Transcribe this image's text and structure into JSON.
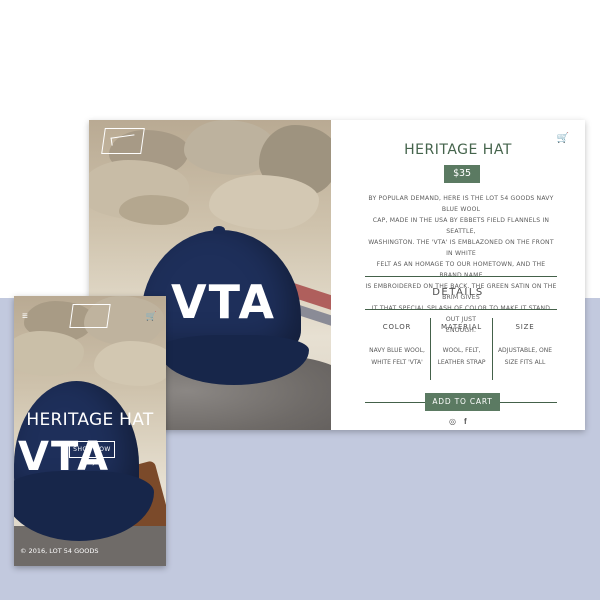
{
  "colors": {
    "accent_green": "#5b7a62",
    "heading_green": "#45644c",
    "navy_cap": "#1e2f5a",
    "backdrop_blue": "#c2c9de"
  },
  "desktop": {
    "title": "HERITAGE HAT",
    "price": "$35",
    "cart_icon": "cart-icon",
    "description_lines": [
      "BY POPULAR DEMAND, HERE IS THE LOT 54 GOODS NAVY BLUE WOOL",
      "CAP, MADE IN THE USA BY EBBETS FIELD FLANNELS IN SEATTLE,",
      "WASHINGTON. THE 'VTA' IS EMBLAZONED ON THE FRONT IN WHITE",
      "FELT AS AN HOMAGE TO OUR HOMETOWN, AND THE BRAND NAME",
      "IS EMBROIDERED ON THE BACK. THE GREEN SATIN ON THE BRIM GIVES",
      "IT THAT SPECIAL SPLASH OF COLOR TO MAKE IT STAND OUT JUST",
      "ENOUGH."
    ],
    "details_heading": "DETAILS",
    "specs": [
      {
        "label": "COLOR",
        "value_lines": [
          "NAVY BLUE WOOL,",
          "WHITE FELT 'VTA'"
        ]
      },
      {
        "label": "MATERIAL",
        "value_lines": [
          "WOOL, FELT,",
          "LEATHER STRAP"
        ]
      },
      {
        "label": "SIZE",
        "value_lines": [
          "ADJUSTABLE, ONE",
          "SIZE FITS ALL"
        ]
      }
    ],
    "add_to_cart": "ADD TO CART",
    "social": {
      "instagram_glyph": "◎",
      "facebook_glyph": "f"
    },
    "photo_text": "VTA"
  },
  "mobile": {
    "menu_glyph": "≡",
    "cart_glyph": "🛒",
    "title": "HERITAGE HAT",
    "shop_now": "SHOP NOW →",
    "copyright": "© 2016, LOT 54 GOODS",
    "photo_text": "VTA"
  }
}
